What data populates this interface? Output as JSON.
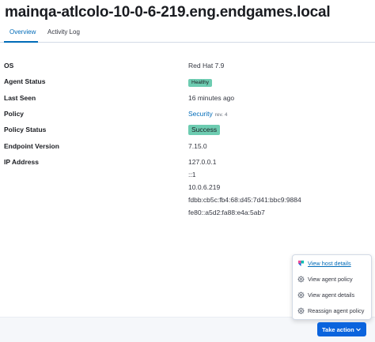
{
  "header": {
    "title": "mainqa-atlcolo-10-0-6-219.eng.endgames.local"
  },
  "tabs": [
    {
      "label": "Overview",
      "active": true
    },
    {
      "label": "Activity Log",
      "active": false
    }
  ],
  "details": {
    "os": {
      "label": "OS",
      "value": "Red Hat 7.9"
    },
    "agent_status": {
      "label": "Agent Status",
      "value": "Healthy"
    },
    "last_seen": {
      "label": "Last Seen",
      "value": "16 minutes ago"
    },
    "policy": {
      "label": "Policy",
      "value": "Security",
      "revision": "rev. 4"
    },
    "policy_status": {
      "label": "Policy Status",
      "value": "Success"
    },
    "endpoint_version": {
      "label": "Endpoint Version",
      "value": "7.15.0"
    },
    "ip_address": {
      "label": "IP Address",
      "values": [
        "127.0.0.1",
        "::1",
        "10.0.6.219",
        "fdbb:cb5c:fb4:68:d45:7d41:bbc9:9884",
        "fe80::a5d2:fa88:e4a:5ab7"
      ]
    }
  },
  "menu": {
    "items": [
      {
        "label": "View host details",
        "icon": "security-app-icon"
      },
      {
        "label": "View agent policy",
        "icon": "gear-icon"
      },
      {
        "label": "View agent details",
        "icon": "gear-icon"
      },
      {
        "label": "Reassign agent policy",
        "icon": "gear-icon"
      }
    ]
  },
  "footer": {
    "take_action_label": "Take action"
  },
  "colors": {
    "accent": "#006bb8",
    "button": "#0b64dd",
    "success_badge": "#6dccb1"
  }
}
